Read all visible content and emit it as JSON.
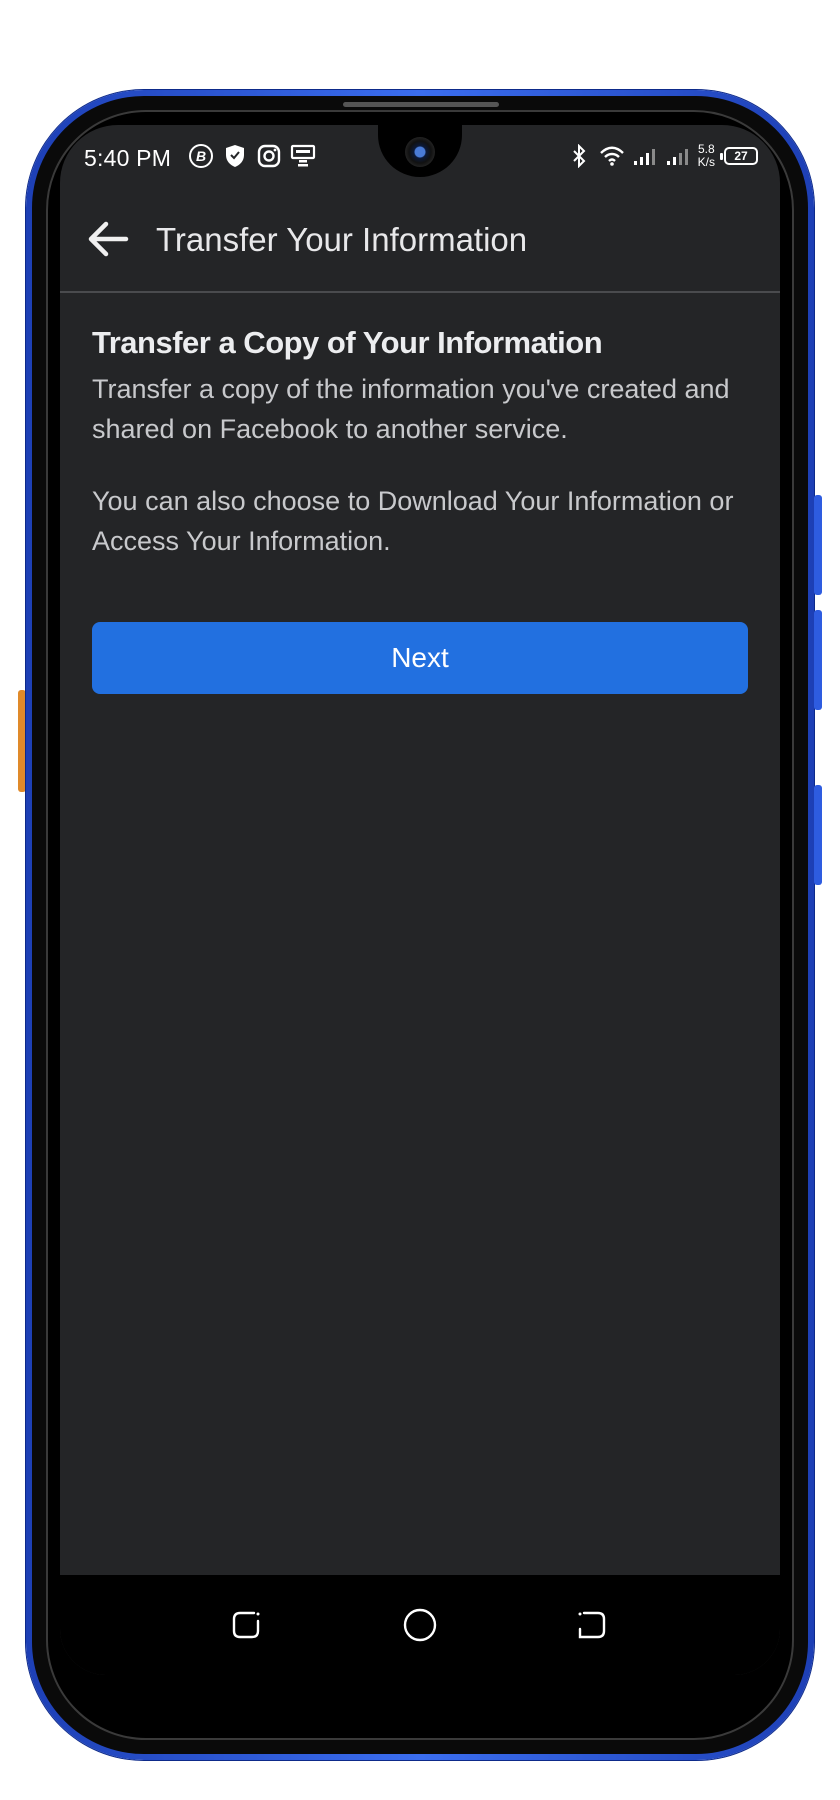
{
  "status_bar": {
    "time": "5:40 PM",
    "net_speed_value": "5.8",
    "net_speed_unit": "K/s",
    "battery": "27",
    "left_icons": [
      "b-circle-icon",
      "shield-icon",
      "instagram-icon",
      "message-tray-icon"
    ],
    "right_icons": [
      "bluetooth-icon",
      "wifi-icon",
      "signal-icon",
      "signal-icon"
    ]
  },
  "header": {
    "title": "Transfer Your Information"
  },
  "main": {
    "heading": "Transfer a Copy of Your Information",
    "paragraph1": "Transfer a copy of the information you've created and shared on Facebook to another service.",
    "paragraph2": "You can also choose to Download Your Information or Access Your Information.",
    "next_label": "Next"
  },
  "colors": {
    "background": "#242527",
    "accent": "#2270e0",
    "frame": "#2e5ce0"
  }
}
